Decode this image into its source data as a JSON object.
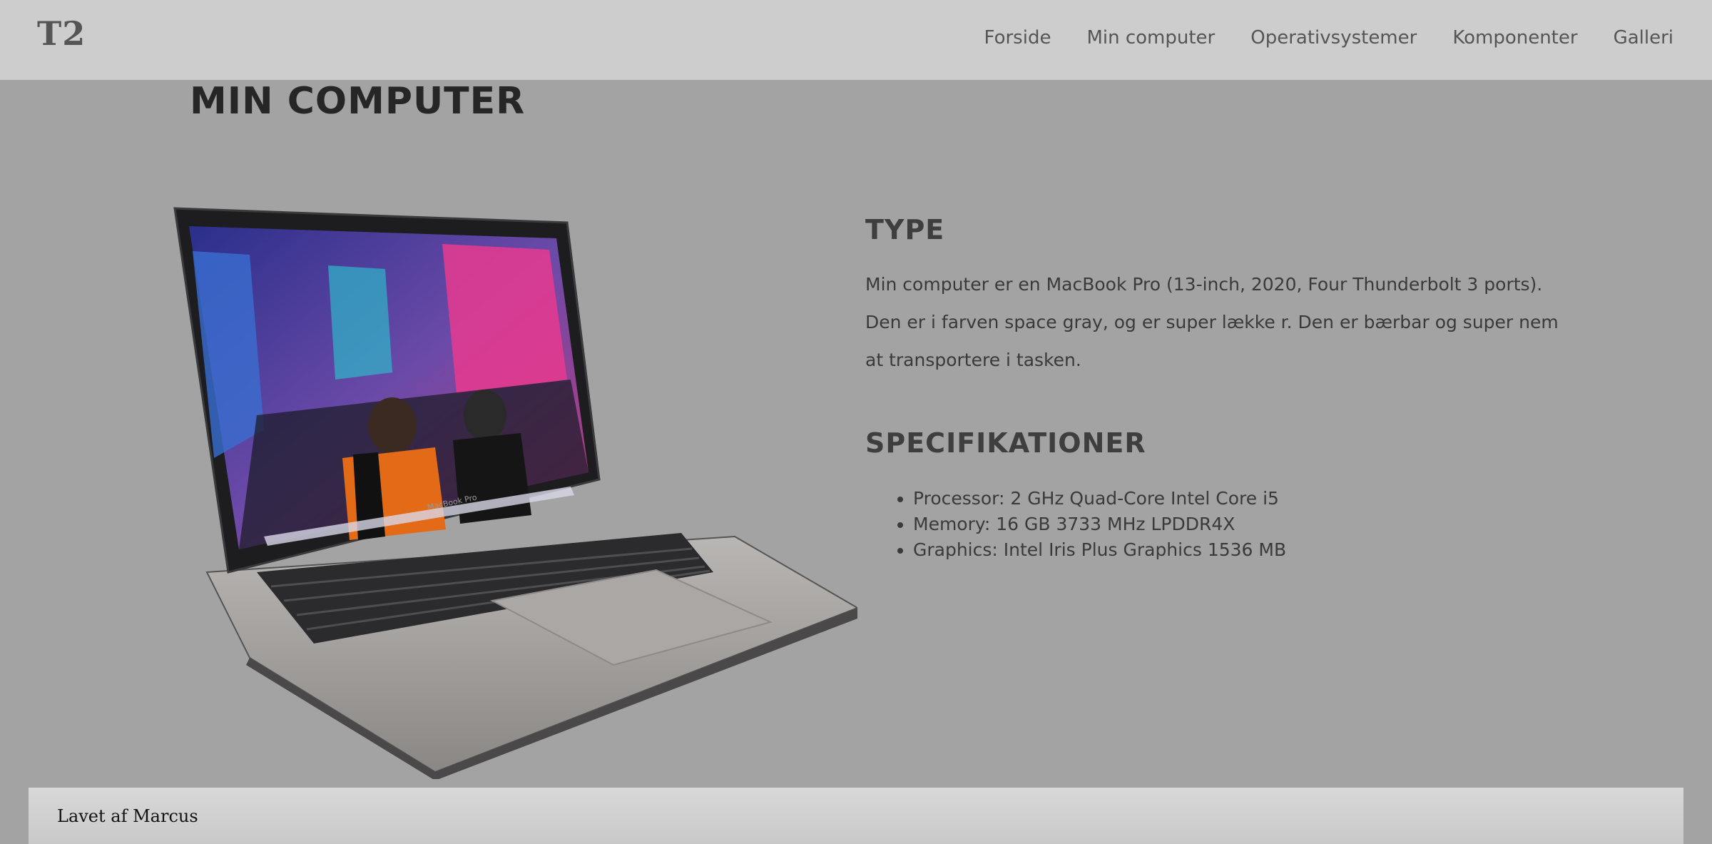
{
  "header": {
    "logo": "T2",
    "nav": [
      "Forside",
      "Min computer",
      "Operativsystemer",
      "Komponenter",
      "Galleri"
    ]
  },
  "main": {
    "title": "MIN COMPUTER",
    "type_heading": "TYPE",
    "type_text": "Min computer er en MacBook Pro (13-inch, 2020, Four Thunderbolt 3 ports). Den er i farven space gray, og er super lække r. Den er bærbar og super nem at transportere i tasken.",
    "spec_heading": "SPECIFIKATIONER",
    "specs": [
      "Processor: 2 GHz Quad-Core Intel Core i5",
      "Memory: 16 GB 3733 MHz LPDDR4X",
      "Graphics: Intel Iris Plus Graphics 1536 MB"
    ],
    "laptop_brand": "MacBook Pro"
  },
  "footer": {
    "text": "Lavet af Marcus"
  }
}
